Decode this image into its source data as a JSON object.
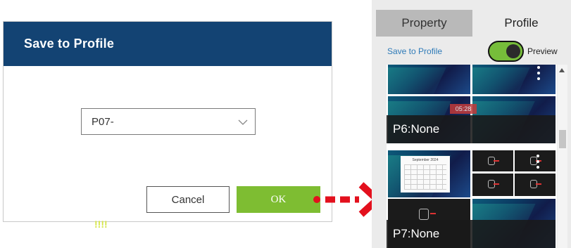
{
  "dialog": {
    "title": "Save to Profile",
    "select_value": "P07-",
    "cancel_label": "Cancel",
    "ok_label": "OK"
  },
  "panel": {
    "tabs": [
      {
        "label": "Property",
        "active": false
      },
      {
        "label": "Profile",
        "active": true
      }
    ],
    "save_link": "Save to Profile",
    "preview_label": "Preview",
    "preview_enabled": true,
    "profiles": [
      {
        "label": "P6:None"
      },
      {
        "label": "P7:None"
      }
    ],
    "calendar_title": "September 2024",
    "clock_text": "05:28",
    "badge_text": "!!!!"
  },
  "colors": {
    "header": "#134373",
    "ok_button": "#7ebd32",
    "toggle": "#76bd3a",
    "arrow": "#e3101d",
    "link": "#2f7bb8"
  }
}
